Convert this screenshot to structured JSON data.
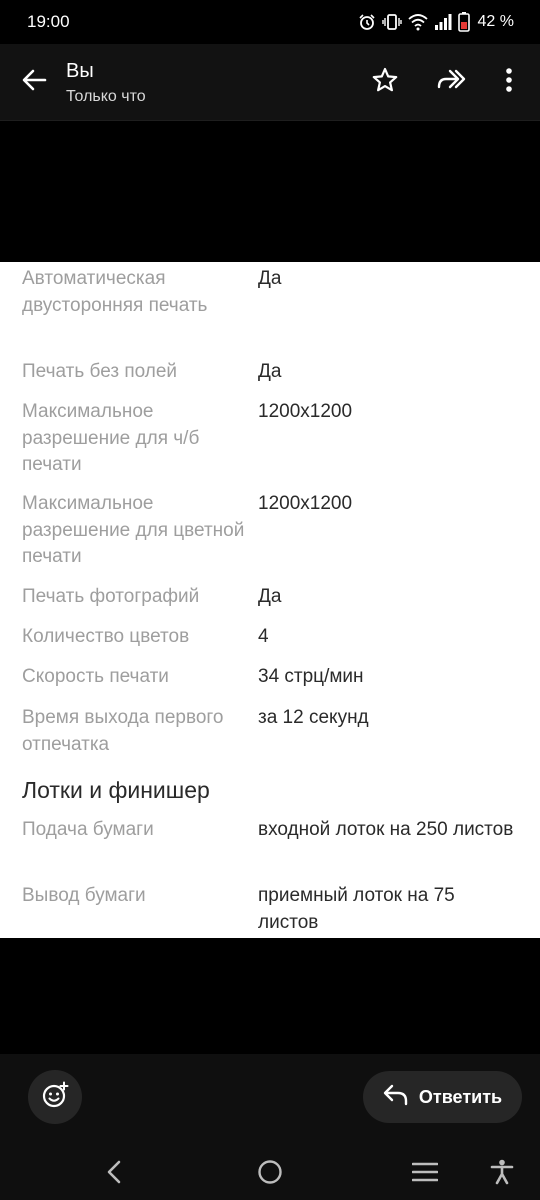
{
  "status_bar": {
    "time": "19:00",
    "battery_percent": "42 %",
    "icons": [
      "alarm-icon",
      "vibrate-icon",
      "wifi-icon",
      "signal-icon",
      "battery-icon"
    ],
    "battery_color": "#e53935"
  },
  "header": {
    "title": "Вы",
    "subtitle": "Только что",
    "icons": [
      "back-arrow-icon",
      "star-icon",
      "forward-icon",
      "more-vert-icon"
    ]
  },
  "specs": [
    {
      "label": "Автоматическая двусторонняя печать",
      "value": "Да"
    },
    {
      "label": "Печать без полей",
      "value": "Да"
    },
    {
      "label": "Максимальное разрешение для ч/б печати",
      "value": "1200x1200"
    },
    {
      "label": "Максимальное разрешение для цветной печати",
      "value": "1200x1200"
    },
    {
      "label": "Печать фотографий",
      "value": "Да"
    },
    {
      "label": "Количество цветов",
      "value": "4"
    },
    {
      "label": "Скорость печати",
      "value": "34 стрц/мин"
    },
    {
      "label": "Время выхода первого отпечатка",
      "value": "за 12 секунд"
    }
  ],
  "section": {
    "heading": "Лотки и финишер",
    "items": [
      {
        "label": "Подача бумаги",
        "value": "входной лоток на 250 листов"
      },
      {
        "label": "Вывод бумаги",
        "value": "приемный лоток на 75 листов"
      }
    ]
  },
  "actions": {
    "reply_label": "Ответить",
    "icons": [
      "emoji-add-icon",
      "reply-icon"
    ]
  },
  "nav": {
    "icons": [
      "nav-back-icon",
      "home-icon",
      "recents-icon",
      "accessibility-icon"
    ]
  }
}
